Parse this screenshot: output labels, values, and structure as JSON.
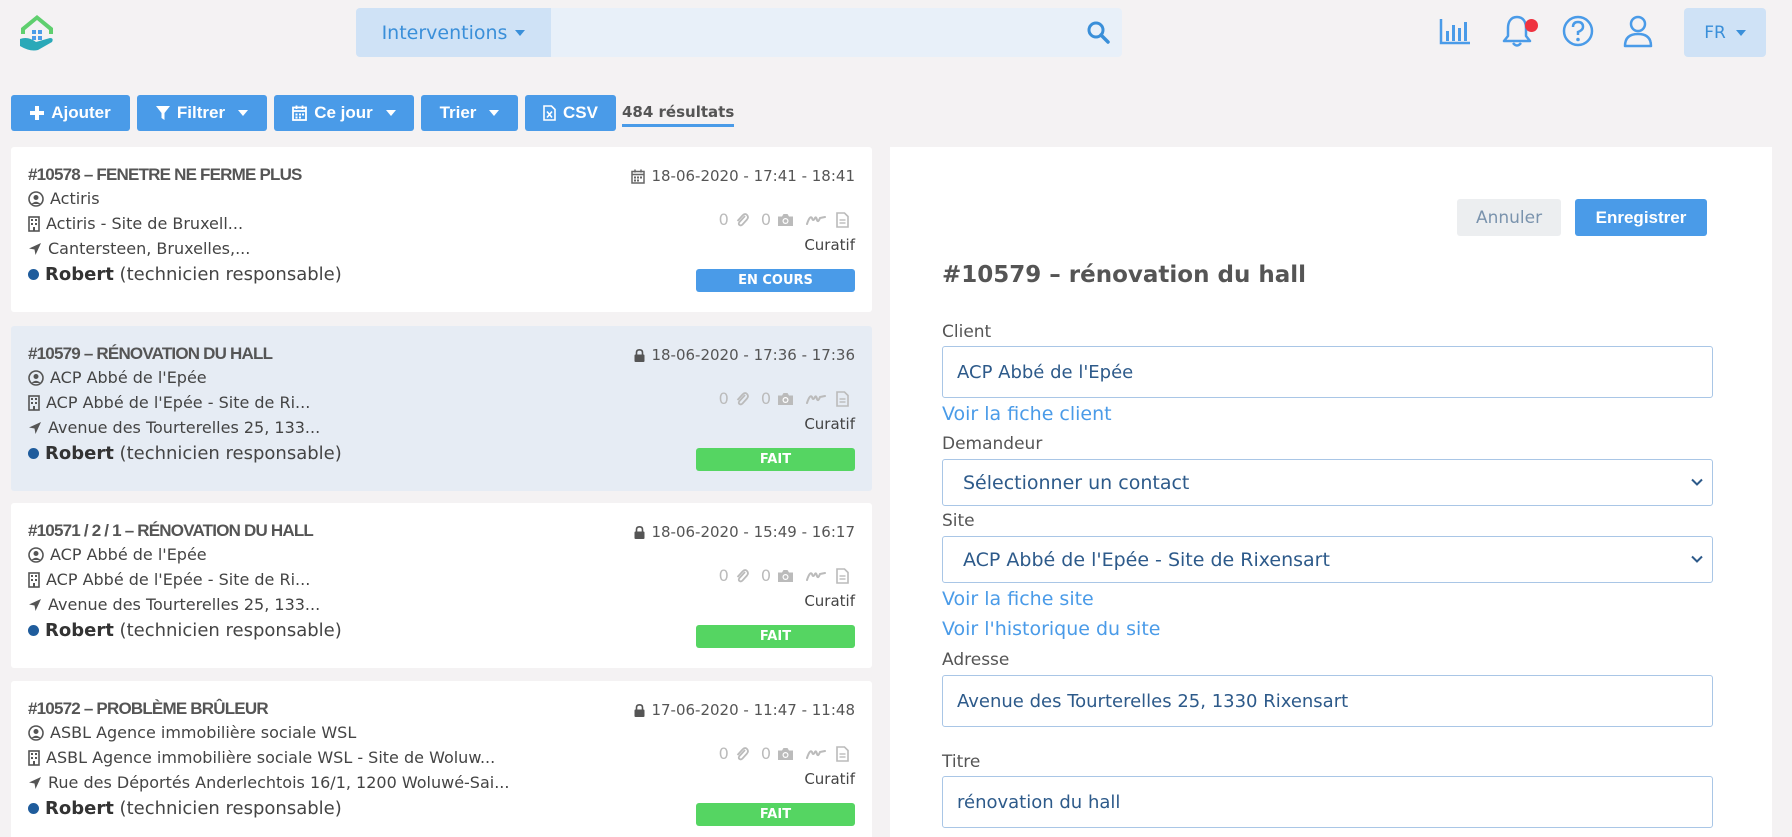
{
  "header": {
    "search_type": "Interventions",
    "search_placeholder": "",
    "lang": "FR",
    "icons": [
      "stats-icon",
      "bell-icon",
      "help-icon",
      "user-icon"
    ]
  },
  "toolbar": {
    "add": "Ajouter",
    "filter": "Filtrer",
    "day": "Ce jour",
    "sort": "Trier",
    "csv": "CSV",
    "results": "484 résultats"
  },
  "cards": [
    {
      "title": "#10578 – FENETRE NE FERME PLUS",
      "date": "18-06-2020 - 17:41 - 18:41",
      "date_icon": "calendar-icon",
      "client": "Actiris",
      "site": "Actiris - Site de Bruxell...",
      "address": "Cantersteen, Bruxelles,...",
      "tech_name": "Robert",
      "tech_role": "(technicien responsable)",
      "attach_count": "0",
      "photo_count": "0",
      "type": "Curatif",
      "status": "EN COURS",
      "status_color": "#4a9be8"
    },
    {
      "title": "#10579 – RÉNOVATION DU HALL",
      "date": "18-06-2020 - 17:36 - 17:36",
      "date_icon": "lock-icon",
      "client": "ACP Abbé de l'Epée",
      "site": "ACP Abbé de l'Epée - Site de Ri...",
      "address": "Avenue des Tourterelles 25, 133...",
      "tech_name": "Robert",
      "tech_role": "(technicien responsable)",
      "attach_count": "0",
      "photo_count": "0",
      "type": "Curatif",
      "status": "FAIT",
      "status_color": "#55d562"
    },
    {
      "title": "#10571 / 2 / 1 – RÉNOVATION DU HALL",
      "date": "18-06-2020 - 15:49 - 16:17",
      "date_icon": "lock-icon",
      "client": "ACP Abbé de l'Epée",
      "site": "ACP Abbé de l'Epée - Site de Ri...",
      "address": "Avenue des Tourterelles 25, 133...",
      "tech_name": "Robert",
      "tech_role": "(technicien responsable)",
      "attach_count": "0",
      "photo_count": "0",
      "type": "Curatif",
      "status": "FAIT",
      "status_color": "#55d562"
    },
    {
      "title": "#10572 – PROBLÈME BRÛLEUR",
      "date": "17-06-2020 - 11:47 - 11:48",
      "date_icon": "lock-icon",
      "client": "ASBL Agence immobilière sociale WSL",
      "site": "ASBL Agence immobilière sociale WSL - Site de Woluw...",
      "address": "Rue des Déportés Anderlechtois 16/1, 1200 Woluwé-Sai...",
      "tech_name": "Robert",
      "tech_role": "(technicien responsable)",
      "attach_count": "0",
      "photo_count": "0",
      "type": "Curatif",
      "status": "FAIT",
      "status_color": "#55d562"
    }
  ],
  "detail": {
    "cancel": "Annuler",
    "save": "Enregistrer",
    "title": "#10579 – rénovation du hall",
    "client_label": "Client",
    "client_value": "ACP Abbé de l'Epée",
    "client_link": "Voir la fiche client",
    "requester_label": "Demandeur",
    "requester_value": "Sélectionner un contact",
    "site_label": "Site",
    "site_value": "ACP Abbé de l'Epée - Site de Rixensart",
    "site_link": "Voir la fiche site",
    "site_history_link": "Voir l'historique du site",
    "address_label": "Adresse",
    "address_value": "Avenue des Tourterelles 25, 1330 Rixensart",
    "title_label": "Titre",
    "title_value": "rénovation du hall"
  }
}
